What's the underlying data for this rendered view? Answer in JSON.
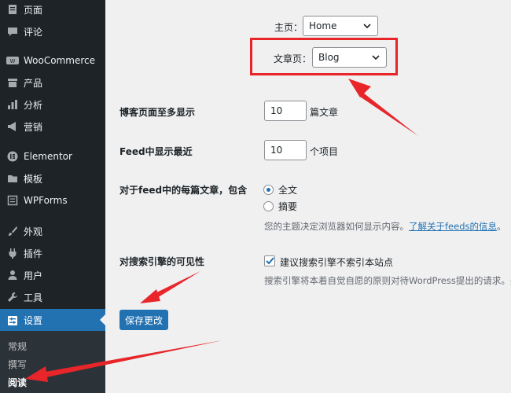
{
  "sidebar": {
    "items": [
      {
        "label": "页面",
        "icon": "page-icon"
      },
      {
        "label": "评论",
        "icon": "comment-icon"
      },
      {
        "label": "WooCommerce",
        "icon": "woocommerce-icon"
      },
      {
        "label": "产品",
        "icon": "archive-icon"
      },
      {
        "label": "分析",
        "icon": "bar-chart-icon"
      },
      {
        "label": "营销",
        "icon": "megaphone-icon"
      },
      {
        "label": "Elementor",
        "icon": "elementor-icon"
      },
      {
        "label": "模板",
        "icon": "folder-icon"
      },
      {
        "label": "WPForms",
        "icon": "form-icon"
      },
      {
        "label": "外观",
        "icon": "paintbrush-icon"
      },
      {
        "label": "插件",
        "icon": "plugin-icon"
      },
      {
        "label": "用户",
        "icon": "user-icon"
      },
      {
        "label": "工具",
        "icon": "wrench-icon"
      },
      {
        "label": "设置",
        "icon": "settings-icon"
      }
    ],
    "submenu": [
      "常规",
      "撰写",
      "阅读"
    ]
  },
  "front_page": {
    "label": "主页：",
    "value": "Home"
  },
  "posts_page": {
    "label": "文章页：",
    "value": "Blog"
  },
  "posts_per_page": {
    "label": "博客页面至多显示",
    "value": "10",
    "unit": "篇文章"
  },
  "feed_items": {
    "label": "Feed中显示最近",
    "value": "10",
    "unit": "个项目"
  },
  "feed_content": {
    "label": "对于feed中的每篇文章，包含",
    "options": [
      "全文",
      "摘要"
    ],
    "selected": "全文",
    "desc": "您的主题决定浏览器如何显示内容。",
    "link": "了解关于feeds的信息",
    "link_suffix": "。"
  },
  "search_visibility": {
    "label": "对搜索引擎的可见性",
    "checkbox_label": "建议搜索引擎不索引本站点",
    "checked": true,
    "desc": "搜索引擎将本着自觉自愿的原则对待WordPress提出的请求。并"
  },
  "save_button": "保存更改",
  "colors": {
    "accent": "#2271b1",
    "sidebar": "#1d2327",
    "highlight": "#e8262a"
  }
}
